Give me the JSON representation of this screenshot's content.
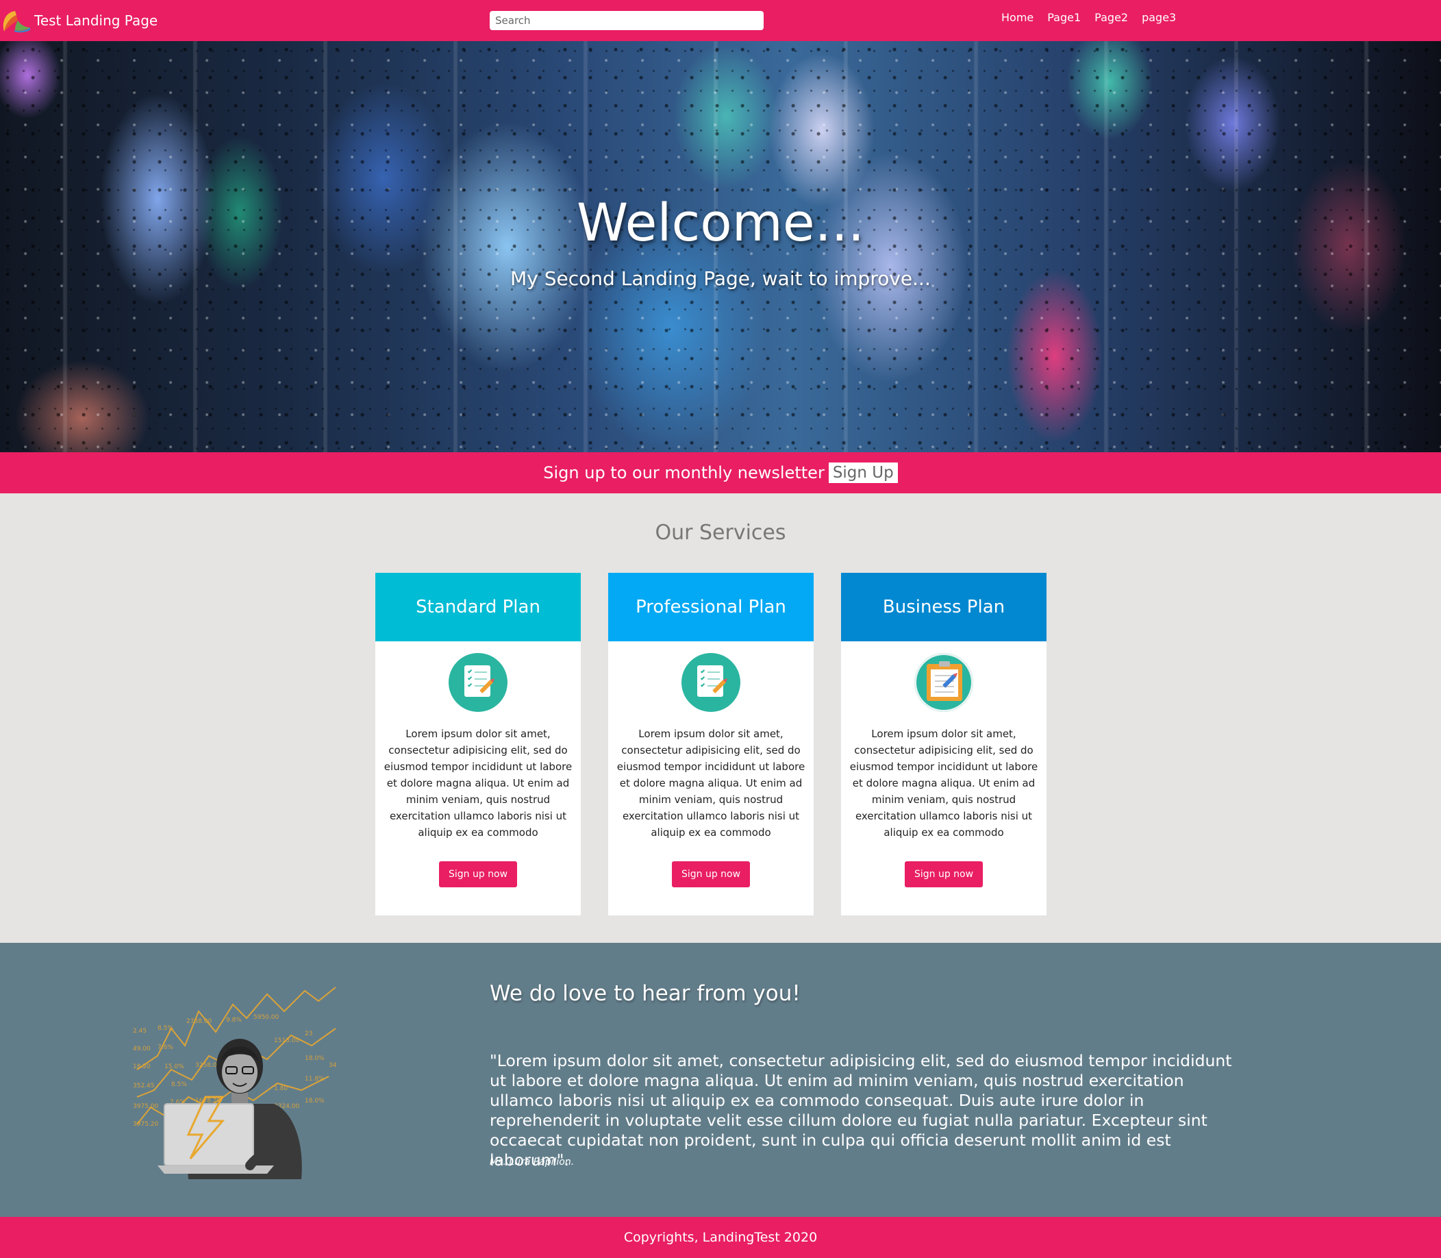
{
  "navbar": {
    "brand_title": "Test Landing Page",
    "search_placeholder": "Search",
    "links": [
      "Home",
      "Page1",
      "Page2",
      "page3"
    ]
  },
  "hero": {
    "title": "Welcome...",
    "subtitle": "My Second Landing Page, wait to improve..."
  },
  "newsletter": {
    "text": "Sign up to our monthly newsletter",
    "button_label": "Sign Up"
  },
  "services": {
    "title": "Our Services",
    "cards": [
      {
        "title": "Standard Plan",
        "color": "#00bcd4",
        "icon": "checklist-icon",
        "text": "Lorem ipsum dolor sit amet, consectetur adipisicing elit, sed do eiusmod tempor incididunt ut labore et dolore magna aliqua. Ut enim ad minim veniam, quis nostrud exercitation ullamco laboris nisi ut aliquip ex ea commodo",
        "button_label": "Sign up now"
      },
      {
        "title": "Professional Plan",
        "color": "#03a9f4",
        "icon": "checklist-icon",
        "text": "Lorem ipsum dolor sit amet, consectetur adipisicing elit, sed do eiusmod tempor incididunt ut labore et dolore magna aliqua. Ut enim ad minim veniam, quis nostrud exercitation ullamco laboris nisi ut aliquip ex ea commodo",
        "button_label": "Sign up now"
      },
      {
        "title": "Business Plan",
        "color": "#0288d1",
        "icon": "clipboard-icon",
        "text": "Lorem ipsum dolor sit amet, consectetur adipisicing elit, sed do eiusmod tempor incididunt ut labore et dolore magna aliqua. Ut enim ad minim veniam, quis nostrud exercitation ullamco laboris nisi ut aliquip ex ea commodo",
        "button_label": "Sign up now"
      }
    ]
  },
  "testimonial": {
    "heading": "We do love to hear from you!",
    "quote": "\"Lorem ipsum dolor sit amet, consectetur adipisicing elit, sed do eiusmod tempor incididunt ut labore et dolore magna aliqua. Ut enim ad minim veniam, quis nostrud exercitation ullamco laboris nisi ut aliquip ex ea commodo consequat. Duis aute irure dolor in reprehenderit in voluptate velit esse cillum dolore eu fugiat nulla pariatur. Excepteur sint occaecat cupidatat non proident, sunt in culpa qui officia deserunt mollit anim id est laborum\".",
    "author": "Ms. Lura Papilion.",
    "illustration": "woman-with-laptop-and-chart-illustration"
  },
  "footer": {
    "text": "Copyrights, LandingTest 2020"
  },
  "colors": {
    "accent": "#e91e63",
    "page_background": "#e5e4e2",
    "testimonial_background": "#627d8a"
  }
}
